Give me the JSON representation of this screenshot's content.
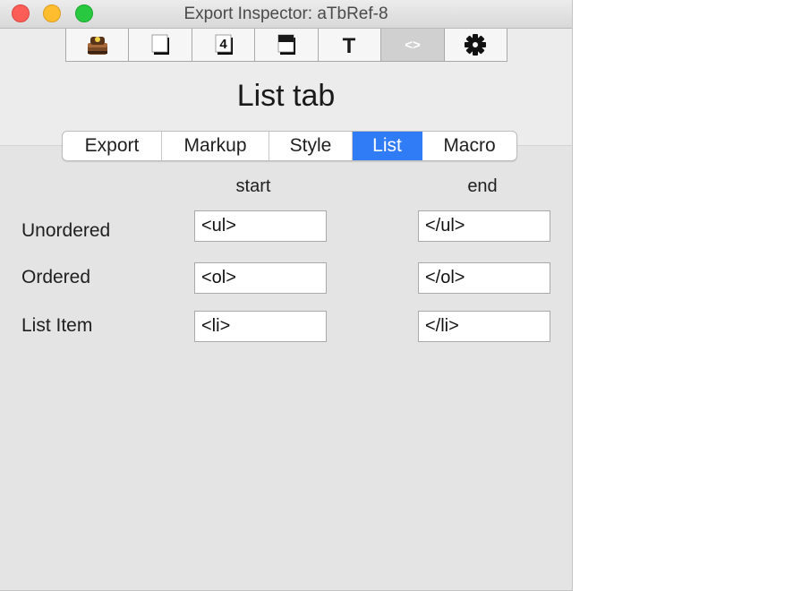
{
  "window": {
    "title": "Export Inspector: aTbRef-8"
  },
  "toolbar": {
    "items": [
      {
        "icon": "stamp-icon",
        "selected": false
      },
      {
        "icon": "page-icon",
        "selected": false
      },
      {
        "icon": "number-page-icon",
        "label": "4",
        "selected": false
      },
      {
        "icon": "template-page-icon",
        "selected": false
      },
      {
        "icon": "text-icon",
        "label": "T",
        "selected": false
      },
      {
        "icon": "code-brackets-icon",
        "label": "<>",
        "selected": true
      },
      {
        "icon": "gear-icon",
        "selected": false
      }
    ]
  },
  "heading": "List tab",
  "tabs": [
    {
      "label": "Export",
      "active": false
    },
    {
      "label": "Markup",
      "active": false
    },
    {
      "label": "Style",
      "active": false
    },
    {
      "label": "List",
      "active": true
    },
    {
      "label": "Macro",
      "active": false
    }
  ],
  "columns": {
    "start": "start",
    "end": "end"
  },
  "rows": [
    {
      "label": "Unordered",
      "start": "<ul>",
      "end": "</ul>"
    },
    {
      "label": "Ordered",
      "start": "<ol>",
      "end": "</ol>"
    },
    {
      "label": "List Item",
      "start": "<li>",
      "end": "</li>"
    }
  ],
  "colors": {
    "accent": "#2f7cf6",
    "close": "#fd5d57",
    "minimize": "#febc2f",
    "zoom": "#28c840"
  }
}
